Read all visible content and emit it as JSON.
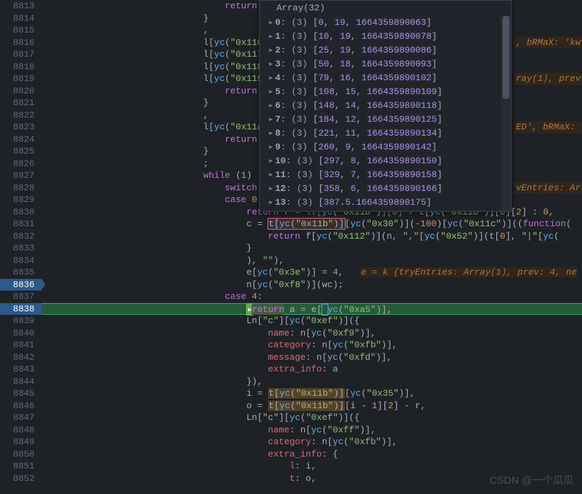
{
  "gutter": {
    "start": 8813,
    "end": 8852,
    "breakpoints": [
      8836,
      8838
    ]
  },
  "code_lines": [
    {
      "n": 8813,
      "html": "                                  <span class='k-return'>return</span>"
    },
    {
      "n": 8814,
      "html": "                              }"
    },
    {
      "n": 8815,
      "html": "                              ,"
    },
    {
      "n": 8816,
      "html": "                              <span class='k-id'>l</span>[<span class='k-fn'>yc</span>(<span class='k-str'>\"0x110</span>"
    },
    {
      "n": 8817,
      "html": "                              <span class='k-id'>l</span>[<span class='k-fn'>yc</span>(<span class='k-str'>\"0x117</span>"
    },
    {
      "n": 8818,
      "html": "                              <span class='k-id'>l</span>[<span class='k-fn'>yc</span>(<span class='k-str'>\"0x118</span>"
    },
    {
      "n": 8819,
      "html": "                              <span class='k-id'>l</span>[<span class='k-fn'>yc</span>(<span class='k-str'>\"0x119</span>"
    },
    {
      "n": 8820,
      "html": "                                  <span class='k-return'>return</span>"
    },
    {
      "n": 8821,
      "html": "                              }"
    },
    {
      "n": 8822,
      "html": "                              ,"
    },
    {
      "n": 8823,
      "html": "                              <span class='k-id'>l</span>[<span class='k-fn'>yc</span>(<span class='k-str'>\"0x11a</span>"
    },
    {
      "n": 8824,
      "html": "                                  <span class='k-return'>return</span>"
    },
    {
      "n": 8825,
      "html": "                              }"
    },
    {
      "n": 8826,
      "html": "                              ;"
    },
    {
      "n": 8827,
      "html": "                              <span class='k-kw'>while</span> (<span class='k-num'>1</span>)"
    },
    {
      "n": 8828,
      "html": "                                  <span class='k-kw'>switch</span>"
    },
    {
      "n": 8829,
      "html": "                                  <span class='k-kw'>case</span> <span class='k-num'>0</span>:"
    },
    {
      "n": 8830,
      "html": "                                      <span class='k-return'>return</span> r = <span class='dim'>lt[</span><span class='k-fn'>yc</span>(<span class='k-str'>\"0x11b\"</span>)<span class='dim'>][</span><span class='k-num'>0</span><span class='dim'>]</span> ? <span class='k-id'>t</span>[<span class='k-fn'>yc</span>(<span class='k-str'>\"0x11b\"</span>)][<span class='k-num'>0</span>][<span class='k-num'>2</span>] : <span class='k-num'>0</span>,"
    },
    {
      "n": 8831,
      "html": "                                      c = <span class='hl-box'><span class='k-id'>t</span>[<span class='k-fn'>yc</span>(<span class='k-str'>\"0x11b\"</span>)]</span>[<span class='k-fn'>yc</span>(<span class='k-str'>\"0x30\"</span>)](<span class='k-num'>-100</span>)[<span class='k-fn'>yc</span>(<span class='k-str'>\"0x11c\"</span>)]((<span class='k-kw'>function</span>("
    },
    {
      "n": 8832,
      "html": "                                          <span class='k-return'>return</span> <span class='k-id'>f</span>[<span class='k-fn'>yc</span>(<span class='k-str'>\"0x112\"</span>)](n, <span class='k-str'>\",\"</span>[<span class='k-fn'>yc</span>(<span class='k-str'>\"0x52\"</span>)](<span class='k-id'>t</span>[<span class='k-num'>0</span>], <span class='k-str'>\"|\"</span>[<span class='k-fn'>yc</span>("
    },
    {
      "n": 8833,
      "html": "                                      }"
    },
    {
      "n": 8834,
      "html": "                                      ), <span class='k-str'>\"\"</span>),"
    },
    {
      "n": 8835,
      "html": "                                      <span class='k-id'>e</span>[<span class='k-fn'>yc</span>(<span class='k-str'>\"0x3e\"</span>)] = <span class='k-num'>4</span>,   <span class='hint'>e = k {tryEntries: Array(1), prev: 4, ne</span>"
    },
    {
      "n": 8836,
      "html": "                                      <span class='k-id'>n</span>[<span class='k-fn'>yc</span>(<span class='k-str'>\"0xf8\"</span>)](wc);"
    },
    {
      "n": 8837,
      "html": "                                  <span class='k-kw'>case</span> <span class='k-num'>4</span>:"
    },
    {
      "n": 8838,
      "html": "                                      <span class='paused-cursor'>&#9656;</span><span style='background:#455a44;'><span class='k-return'>return</span></span> a = <span class='k-id'>e</span>[<span style='outline:1px solid #5aa5e0;'>&nbsp;</span><span class='k-fn'>yc</span>(<span class='k-str'>\"0xa5\"</span>)],",
      "exec": true
    },
    {
      "n": 8839,
      "html": "                                      <span class='k-id'>Ln</span>[<span class='k-str'>\"c\"</span>][<span class='k-fn'>yc</span>(<span class='k-str'>\"0xef\"</span>)]({"
    },
    {
      "n": 8840,
      "html": "                                          <span class='k-prop'>name</span>: <span class='k-id'>n</span>[<span class='k-fn'>yc</span>(<span class='k-str'>\"0xf9\"</span>)],"
    },
    {
      "n": 8841,
      "html": "                                          <span class='k-prop'>category</span>: <span class='k-id'>n</span>[<span class='k-fn'>yc</span>(<span class='k-str'>\"0xfb\"</span>)],"
    },
    {
      "n": 8842,
      "html": "                                          <span class='k-prop'>message</span>: <span class='k-id'>n</span>[<span class='k-fn'>yc</span>(<span class='k-str'>\"0xfd\"</span>)],"
    },
    {
      "n": 8843,
      "html": "                                          <span class='k-prop'>extra_info</span>: a"
    },
    {
      "n": 8844,
      "html": "                                      }),"
    },
    {
      "n": 8845,
      "html": "                                      i = <span class='hl-ref'><span class='k-id'>t</span>[<span class='k-fn'>yc</span>(<span class='k-str'>\"0x11b\"</span>)]</span>[<span class='k-fn'>yc</span>(<span class='k-str'>\"0x35\"</span>)],"
    },
    {
      "n": 8846,
      "html": "                                      o = <span class='hl-ref'><span class='k-id'>t</span>[<span class='k-fn'>yc</span>(<span class='k-str'>\"0x11b\"</span>)]</span>[i - <span class='k-num'>1</span>][<span class='k-num'>2</span>] - r,"
    },
    {
      "n": 8847,
      "html": "                                      <span class='k-id'>Ln</span>[<span class='k-str'>\"c\"</span>][<span class='k-fn'>yc</span>(<span class='k-str'>\"0xef\"</span>)]({"
    },
    {
      "n": 8848,
      "html": "                                          <span class='k-prop'>name</span>: <span class='k-id'>n</span>[<span class='k-fn'>yc</span>(<span class='k-str'>\"0xff\"</span>)],"
    },
    {
      "n": 8849,
      "html": "                                          <span class='k-prop'>category</span>: <span class='k-id'>n</span>[<span class='k-fn'>yc</span>(<span class='k-str'>\"0xfb\"</span>)],"
    },
    {
      "n": 8850,
      "html": "                                          <span class='k-prop'>extra_info</span>: {"
    },
    {
      "n": 8851,
      "html": "                                              <span class='k-prop'>l</span>: i,"
    },
    {
      "n": 8852,
      "html": "                                              <span class='k-prop'>t</span>: o,"
    }
  ],
  "right_hints": {
    "8816": ", bRMaX: 'kw",
    "8819": "ray(1), prev",
    "8823": "ED', bRMaX: ",
    "8828": "vEntries: Ar"
  },
  "debug_panel": {
    "header": "Array(32)",
    "rows": [
      {
        "idx": "0",
        "len": 3,
        "vals": [
          0,
          19,
          1664359890063
        ]
      },
      {
        "idx": "1",
        "len": 3,
        "vals": [
          10,
          19,
          1664359890078
        ]
      },
      {
        "idx": "2",
        "len": 3,
        "vals": [
          25,
          19,
          1664359890086
        ]
      },
      {
        "idx": "3",
        "len": 3,
        "vals": [
          50,
          18,
          1664359890093
        ]
      },
      {
        "idx": "4",
        "len": 3,
        "vals": [
          79,
          16,
          1664359890102
        ]
      },
      {
        "idx": "5",
        "len": 3,
        "vals": [
          108,
          15,
          1664359890109
        ]
      },
      {
        "idx": "6",
        "len": 3,
        "vals": [
          148,
          14,
          1664359890118
        ]
      },
      {
        "idx": "7",
        "len": 3,
        "vals": [
          184,
          12,
          1664359890125
        ]
      },
      {
        "idx": "8",
        "len": 3,
        "vals": [
          221,
          11,
          1664359890134
        ]
      },
      {
        "idx": "9",
        "len": 3,
        "vals": [
          260,
          9,
          1664359890142
        ]
      },
      {
        "idx": "10",
        "len": 3,
        "vals": [
          297,
          8,
          1664359890150
        ]
      },
      {
        "idx": "11",
        "len": 3,
        "vals": [
          329,
          7,
          1664359890158
        ]
      },
      {
        "idx": "12",
        "len": 3,
        "vals": [
          358,
          6,
          1664359890166
        ]
      },
      {
        "idx": "13",
        "len": 3,
        "vals": [
          387,
          5,
          1664359890175
        ],
        "sep": "."
      }
    ]
  },
  "watermark": "CSDN @一个瓜瓜"
}
